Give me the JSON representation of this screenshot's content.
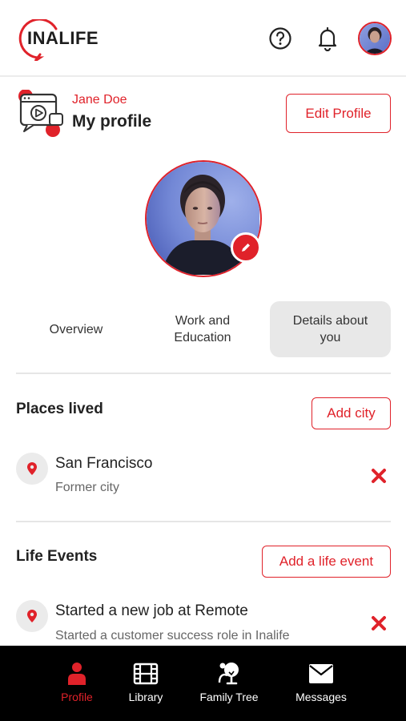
{
  "header": {
    "logo_text": "INALIFE",
    "help_icon": "question-circle-icon",
    "notification_icon": "bell-icon"
  },
  "profile_header": {
    "user_name": "Jane Doe",
    "page_title": "My profile",
    "edit_label": "Edit Profile"
  },
  "tabs": [
    {
      "label": "Overview",
      "active": false
    },
    {
      "label": "Work and Education",
      "active": false
    },
    {
      "label": "Details about you",
      "active": true
    }
  ],
  "places": {
    "title": "Places lived",
    "add_label": "Add city",
    "items": [
      {
        "title": "San Francisco",
        "subtitle": "Former city"
      }
    ]
  },
  "life_events": {
    "title": "Life Events",
    "add_label": "Add a life event",
    "items": [
      {
        "title": "Started a new job at Remote",
        "subtitle": "Started a customer success role in Inalife"
      }
    ]
  },
  "bottom_nav": [
    {
      "label": "Profile",
      "icon": "person-icon",
      "active": true
    },
    {
      "label": "Library",
      "icon": "film-icon",
      "active": false
    },
    {
      "label": "Family Tree",
      "icon": "family-tree-icon",
      "active": false
    },
    {
      "label": "Messages",
      "icon": "envelope-icon",
      "active": false
    }
  ],
  "colors": {
    "accent": "#e0222a",
    "nav_background": "#000000",
    "tab_active_background": "#e8e8e8"
  }
}
